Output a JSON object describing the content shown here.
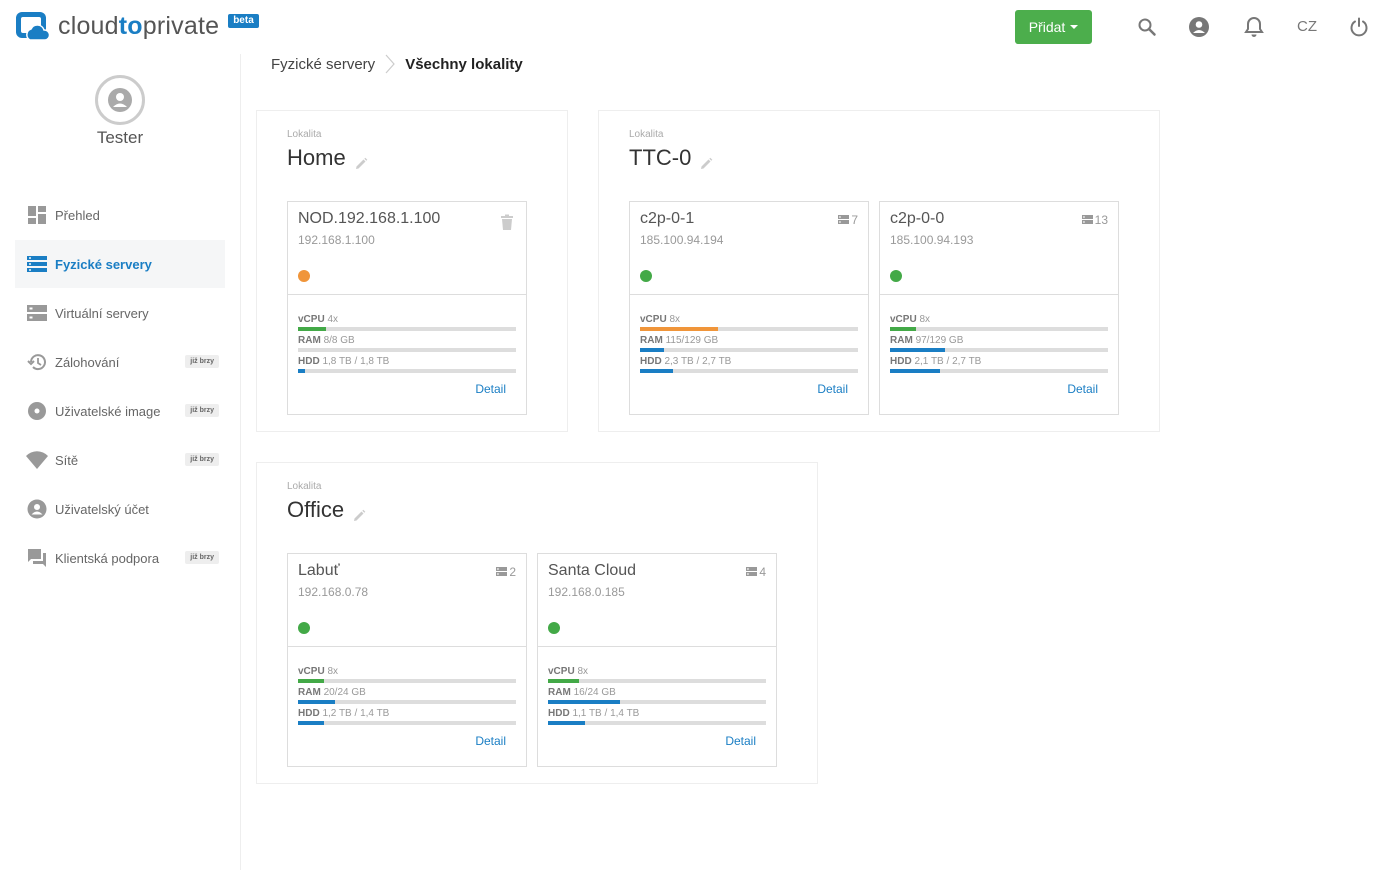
{
  "brand": {
    "name_prefix": "cloud",
    "name_accent": "to",
    "name_suffix": "private",
    "badge": "beta",
    "color": "#1a7ec4"
  },
  "header": {
    "add_label": "Přidat",
    "lang": "CZ",
    "add_color": "#4cae4c"
  },
  "user": {
    "name": "Tester"
  },
  "sidebar": {
    "items": [
      {
        "label": "Přehled",
        "icon": "dashboard-icon",
        "active": false
      },
      {
        "label": "Fyzické servery",
        "icon": "servers-icon",
        "active": true
      },
      {
        "label": "Virtuální servery",
        "icon": "virtual-servers-icon",
        "active": false
      },
      {
        "label": "Zálohování",
        "icon": "backup-icon",
        "badge": "již brzy",
        "active": false
      },
      {
        "label": "Uživatelské image",
        "icon": "disc-icon",
        "badge": "již brzy",
        "active": false
      },
      {
        "label": "Sítě",
        "icon": "wifi-icon",
        "badge": "již brzy",
        "active": false
      },
      {
        "label": "Uživatelský účet",
        "icon": "account-icon",
        "active": false
      },
      {
        "label": "Klientská podpora",
        "icon": "chat-icon",
        "badge": "již brzy",
        "active": false
      }
    ]
  },
  "breadcrumb": {
    "parent": "Fyzické servery",
    "current": "Všechny lokality"
  },
  "location_caption": "Lokalita",
  "detail_label": "Detail",
  "labels": {
    "vcpu": "vCPU",
    "ram": "RAM",
    "hdd": "HDD"
  },
  "status_colors": {
    "warning": "#f0953a",
    "ok": "#43a947"
  },
  "bar_colors": {
    "cpu_ok": "#43a947",
    "cpu_warn": "#f0953a",
    "mem": "#1a7ec4"
  },
  "locations": [
    {
      "name": "Home",
      "servers": [
        {
          "name": "NOD.192.168.1.100",
          "ip": "192.168.1.100",
          "badge": "",
          "status": "warning",
          "trash": true,
          "vcpu": "4x",
          "vcpu_pct": 13,
          "vcpu_color": "cpu_ok",
          "ram": "8/8 GB",
          "ram_pct": 0,
          "hdd": "1,8 TB / 1,8 TB",
          "hdd_pct": 3
        }
      ]
    },
    {
      "name": "TTC-0",
      "servers": [
        {
          "name": "c2p-0-1",
          "ip": "185.100.94.194",
          "badge": "7",
          "status": "ok",
          "vcpu": "8x",
          "vcpu_pct": 36,
          "vcpu_color": "cpu_warn",
          "ram": "115/129 GB",
          "ram_pct": 11,
          "hdd": "2,3 TB / 2,7 TB",
          "hdd_pct": 15
        },
        {
          "name": "c2p-0-0",
          "ip": "185.100.94.193",
          "badge": "13",
          "status": "ok",
          "vcpu": "8x",
          "vcpu_pct": 12,
          "vcpu_color": "cpu_ok",
          "ram": "97/129 GB",
          "ram_pct": 25,
          "hdd": "2,1 TB / 2,7 TB",
          "hdd_pct": 23
        }
      ]
    },
    {
      "name": "Office",
      "servers": [
        {
          "name": "Labuť",
          "ip": "192.168.0.78",
          "badge": "2",
          "status": "ok",
          "vcpu": "8x",
          "vcpu_pct": 12,
          "vcpu_color": "cpu_ok",
          "ram": "20/24 GB",
          "ram_pct": 17,
          "hdd": "1,2 TB / 1,4 TB",
          "hdd_pct": 12
        },
        {
          "name": "Santa Cloud",
          "ip": "192.168.0.185",
          "badge": "4",
          "status": "ok",
          "vcpu": "8x",
          "vcpu_pct": 14,
          "vcpu_color": "cpu_ok",
          "ram": "16/24 GB",
          "ram_pct": 33,
          "hdd": "1,1 TB / 1,4 TB",
          "hdd_pct": 17
        }
      ]
    }
  ]
}
